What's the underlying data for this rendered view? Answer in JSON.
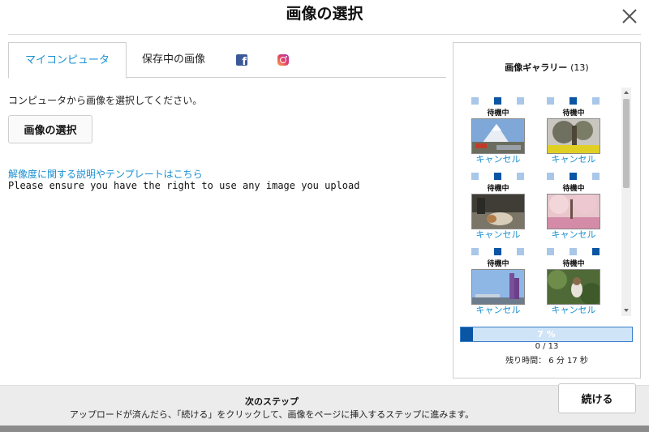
{
  "dialog": {
    "title": "画像の選択"
  },
  "tabs": [
    {
      "label": "マイコンピュータ"
    },
    {
      "label": "保存中の画像"
    },
    {
      "label": "facebook",
      "icon": "facebook-icon",
      "color": "#3b5998"
    },
    {
      "label": "instagram",
      "icon": "instagram-icon"
    }
  ],
  "main": {
    "instruction": "コンピュータから画像を選択してください。",
    "select_button": "画像の選択",
    "help_link": "解像度に関する説明やテンプレートはこちら",
    "rights_note": "Please ensure you have the right to use any image you upload"
  },
  "gallery": {
    "heading": "画像ギャラリー",
    "count": "(13)",
    "items": [
      {
        "status": "待機中",
        "cancel": "キャンセル",
        "active_dot": 1
      },
      {
        "status": "待機中",
        "cancel": "キャンセル",
        "active_dot": 1
      },
      {
        "status": "待機中",
        "cancel": "キャンセル",
        "active_dot": 1
      },
      {
        "status": "待機中",
        "cancel": "キャンセル",
        "active_dot": 1
      },
      {
        "status": "待機中",
        "cancel": "キャンセル",
        "active_dot": 1
      },
      {
        "status": "待機中",
        "cancel": "キャンセル",
        "active_dot": 2
      }
    ],
    "progress_percent": 7,
    "progress_label": "7 %",
    "progress_count": "0 / 13",
    "remaining": "残り時間： 6 分 17 秒"
  },
  "footer": {
    "next_step_title": "次のステップ",
    "next_step_desc": "アップロードが済んだら、「続ける」をクリックして、画像をページに挿入するステップに進みます。",
    "continue_button": "続ける"
  },
  "colors": {
    "accent": "#1a8fd0",
    "progress_fill": "#0b56a4",
    "progress_track": "#cfe4f7"
  }
}
